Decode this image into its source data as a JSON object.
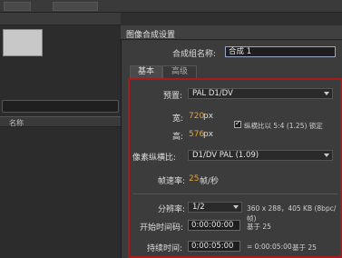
{
  "dialog": {
    "title": "图像合成设置",
    "comp_name_label": "合成组名称:",
    "comp_name_value": "合成 1"
  },
  "tabs": [
    {
      "label": "基本"
    },
    {
      "label": "高级"
    }
  ],
  "left_panel": {
    "column_header": "名称"
  },
  "settings": {
    "preset_label": "预置:",
    "preset_value": "PAL D1/DV",
    "width_label": "宽:",
    "width_value": "720",
    "width_unit": "px",
    "height_label": "高:",
    "height_value": "576",
    "height_unit": "px",
    "lock_aspect_label": "纵横比以 5:4 (1.25) 锁定",
    "pixel_aspect_label": "像素纵横比:",
    "pixel_aspect_value": "D1/DV PAL (1.09)",
    "framerate_label": "帧速率:",
    "framerate_value": "25",
    "framerate_unit": "帧/秒",
    "resolution_label": "分辨率:",
    "resolution_value": "1/2",
    "resolution_info": "360 x 288，405 KB (8bpc/帧)",
    "start_timecode_label": "开始时间码:",
    "start_timecode_value": "0:00:00:00",
    "start_base": "基于 25",
    "duration_label": "持续时间:",
    "duration_value": "0:00:05:00",
    "duration_eq": "= 0:00:05:00",
    "duration_base": "基于 25"
  }
}
